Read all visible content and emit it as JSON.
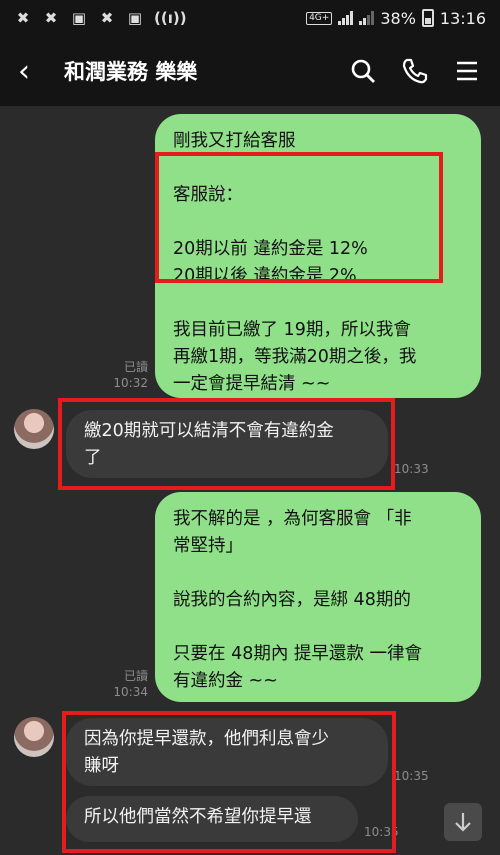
{
  "status_bar": {
    "left_icons": [
      "x-app-icon",
      "x-app-icon",
      "news-icon",
      "x-app-icon",
      "news-icon",
      "signal-wave-icon"
    ],
    "network_label": "4G+",
    "battery_percent": "38%",
    "time": "13:16"
  },
  "header": {
    "title": "和潤業務 樂樂"
  },
  "messages": [
    {
      "side": "out",
      "text": "剛我又打給客服\n\n客服說：\n\n20期以前 違約金是 12%\n20期以後 違約金是 2%\n\n我目前已繳了 19期，所以我會\n再繳1期，等我滿20期之後，我\n一定會提早結清 ~~",
      "read": "已讀",
      "time": "10:32"
    },
    {
      "side": "in",
      "text": "繳20期就可以結清不會有違約金\n了",
      "time": "10:33"
    },
    {
      "side": "out",
      "text": "我不解的是 ，為何客服會 「非\n常堅持」\n\n說我的合約內容，是綁 48期的\n\n只要在 48期內 提早還款 一律會\n有違約金 ~~",
      "read": "已讀",
      "time": "10:34"
    },
    {
      "side": "in",
      "text": "因為你提早還款，他們利息會少\n賺呀",
      "time": "10:35"
    },
    {
      "side": "in",
      "text": "所以他們當然不希望你提早還",
      "time": "10:35"
    }
  ],
  "colors": {
    "outgoing_bubble": "#8fe089",
    "incoming_bubble": "#3a3a3a",
    "highlight_box": "#e51c1c"
  }
}
